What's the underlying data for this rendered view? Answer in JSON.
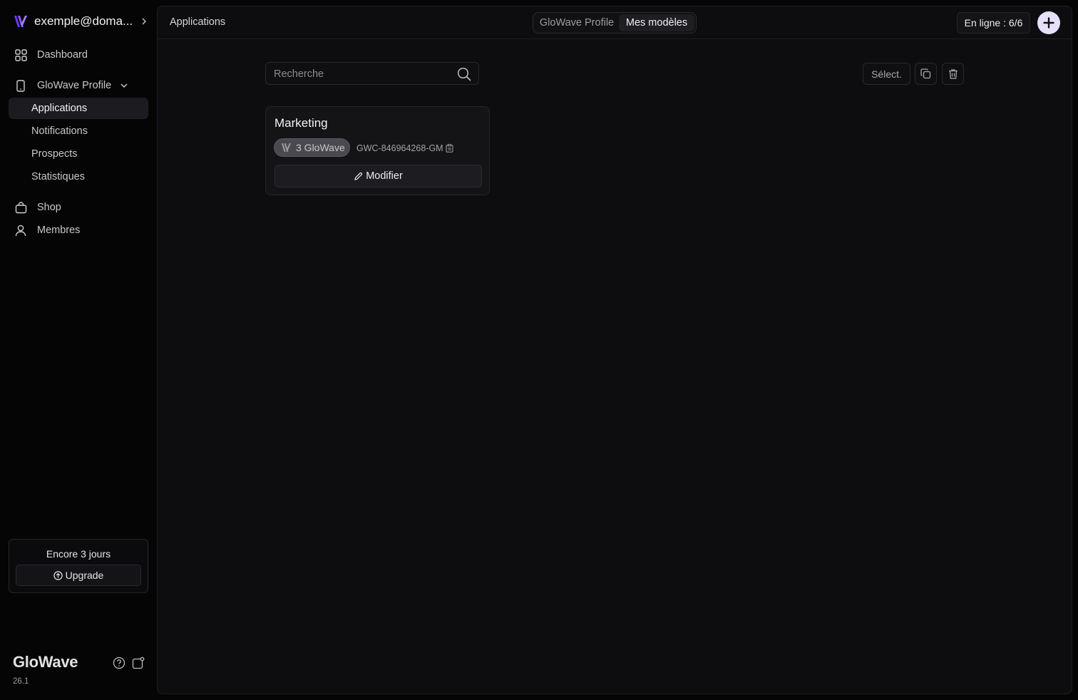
{
  "account": {
    "email": "exemple@doma..."
  },
  "sidebar": {
    "items": [
      {
        "label": "Dashboard",
        "icon": "grid-icon"
      },
      {
        "label": "GloWave Profile",
        "icon": "phone-icon"
      },
      {
        "label": "Applications"
      },
      {
        "label": "Notifications"
      },
      {
        "label": "Prospects"
      },
      {
        "label": "Statistiques"
      },
      {
        "label": "Shop",
        "icon": "bag-icon"
      },
      {
        "label": "Membres",
        "icon": "user-icon"
      }
    ]
  },
  "trial": {
    "text": "Encore 3 jours",
    "upgrade_label": "Upgrade"
  },
  "footer": {
    "brand": "GloWave",
    "version": "26.1"
  },
  "header": {
    "breadcrumb": "Applications",
    "tabs": [
      {
        "label": "GloWave Profile"
      },
      {
        "label": "Mes modèles"
      }
    ],
    "online_status": "En ligne : 6/6"
  },
  "toolbar": {
    "search_placeholder": "Recherche",
    "select_label": "Sélect."
  },
  "cards": [
    {
      "title": "Marketing",
      "badge": "3 GloWave",
      "code": "GWC-846964268-GM",
      "edit_label": "Modifier"
    }
  ],
  "colors": {
    "accent": "#7c4dff",
    "add_button_bg": "#e6e0fb"
  }
}
